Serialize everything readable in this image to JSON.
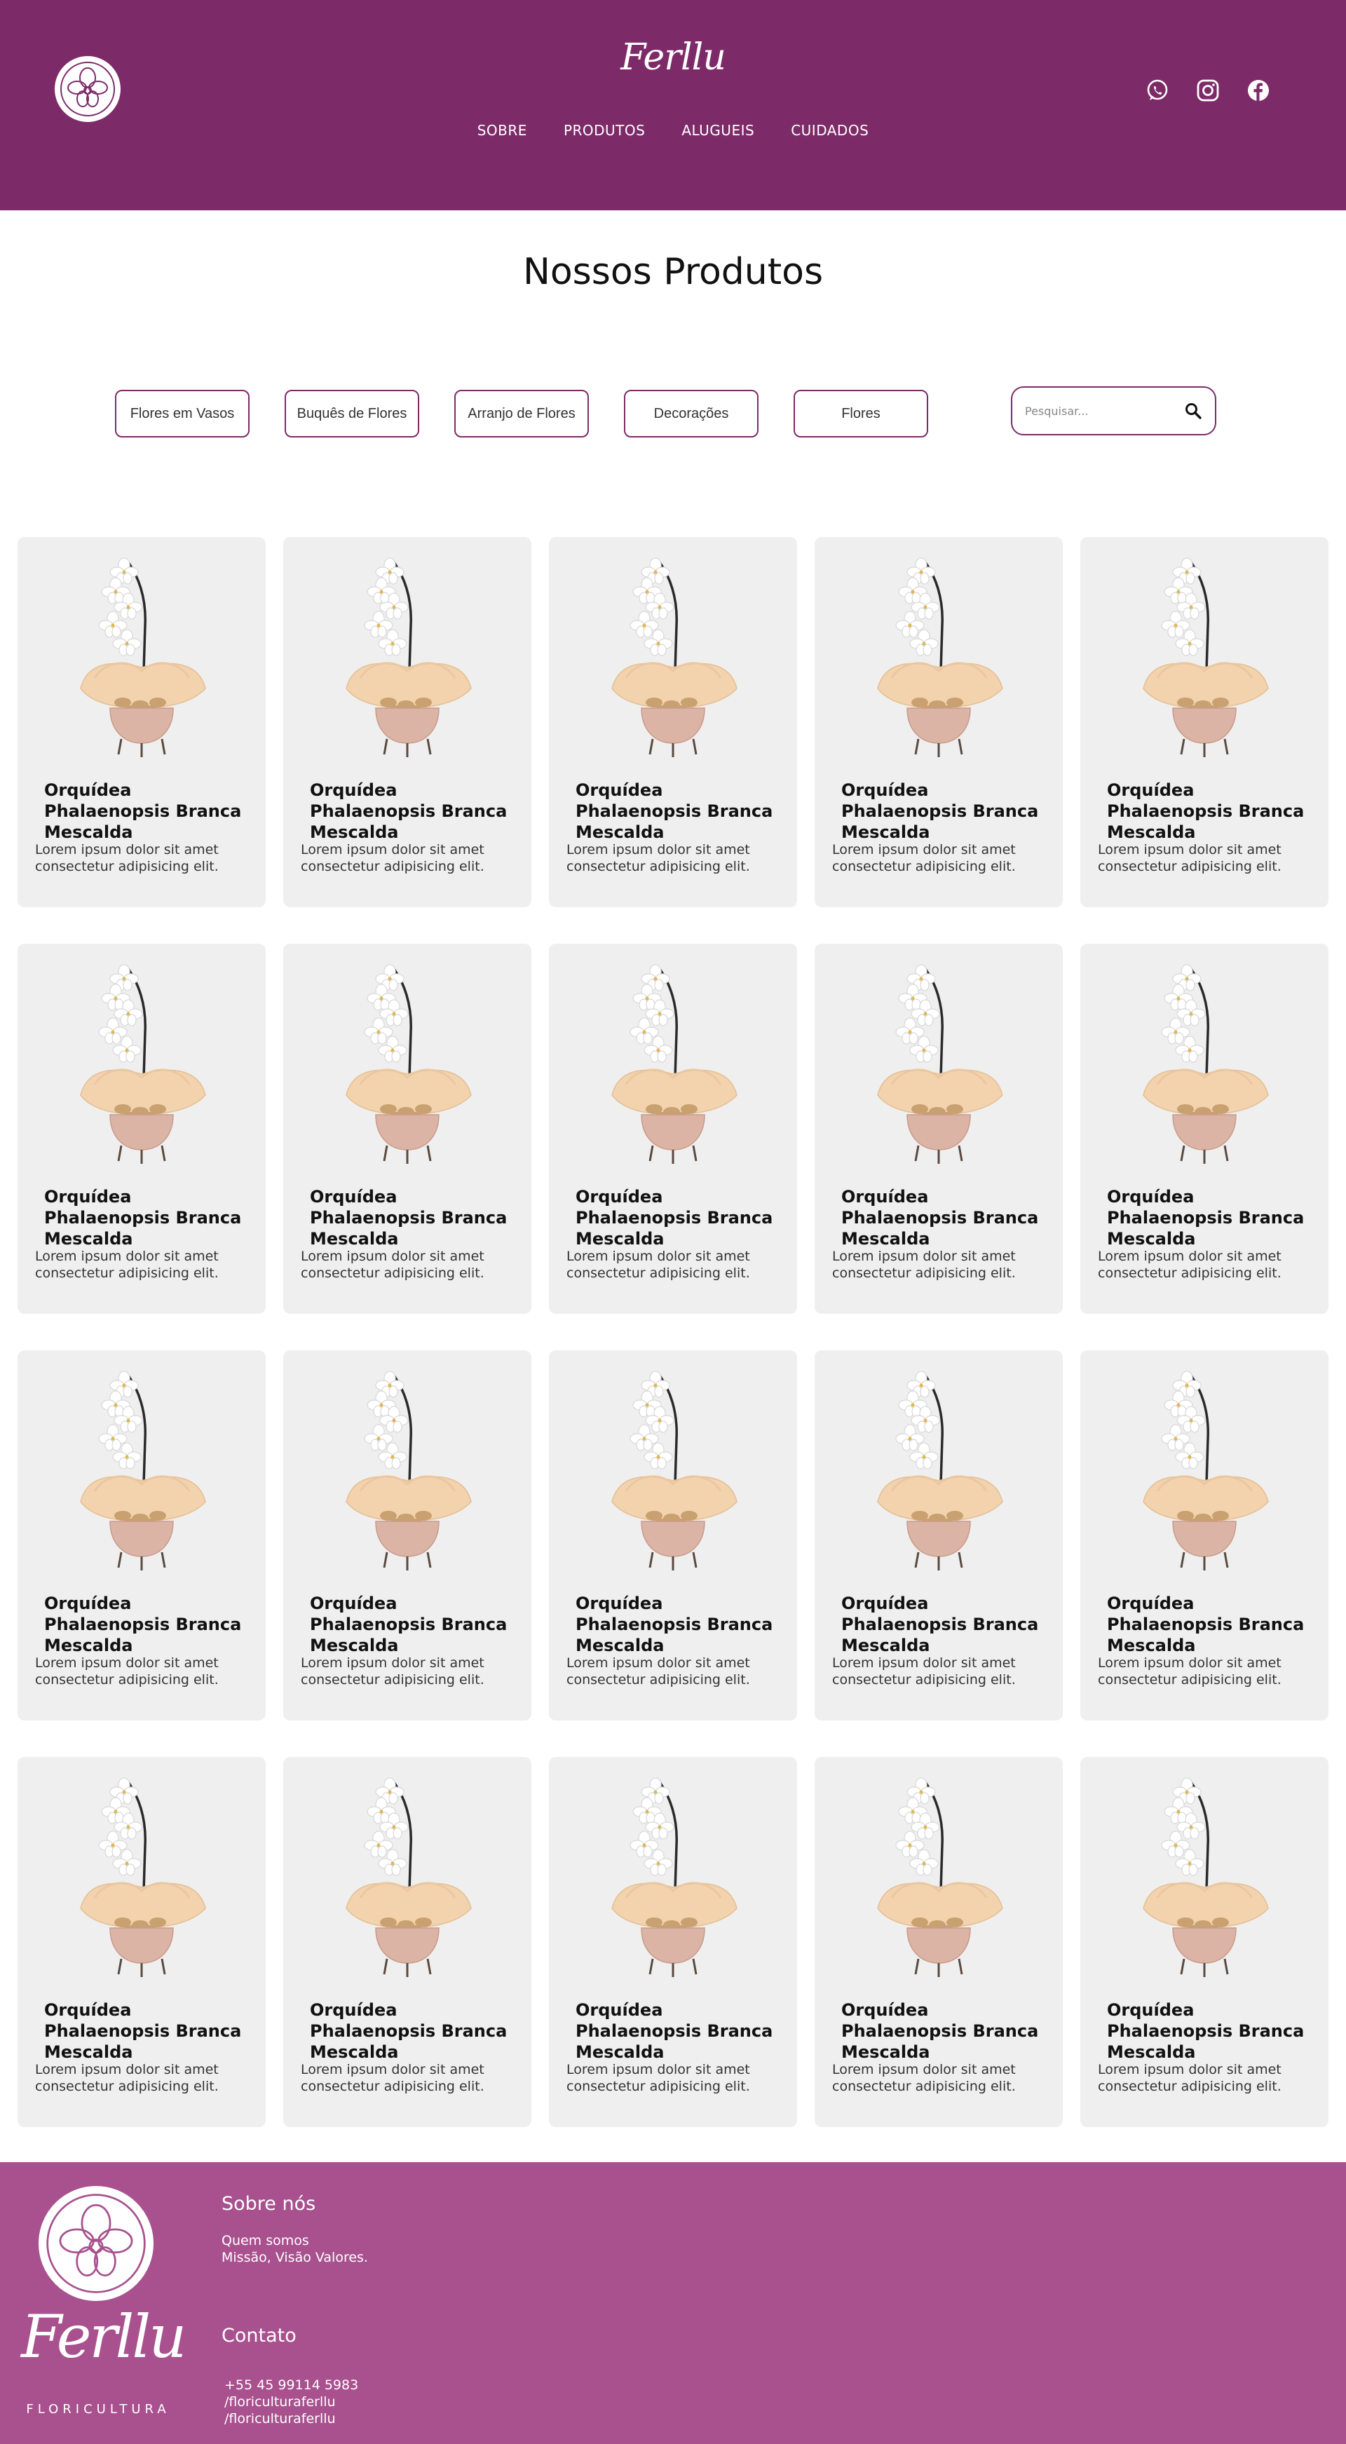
{
  "header": {
    "brand": "Ferllu",
    "nav": [
      "SOBRE",
      "PRODUTOS",
      "ALUGUEIS",
      "CUIDADOS"
    ],
    "social_icons": [
      "whatsapp-icon",
      "instagram-icon",
      "facebook-icon"
    ]
  },
  "page_title": "Nossos Produtos",
  "filters": [
    "Flores em Vasos",
    "Buquês de Flores",
    "Arranjo de Flores",
    "Decorações",
    "Flores"
  ],
  "search": {
    "placeholder": "Pesquisar..."
  },
  "product_image": "white-phalaenopsis-orchid-in-pink-pot",
  "products": [
    {
      "title": "Orquídea Phalaenopsis Branca Mescalda",
      "desc": "Lorem ipsum dolor sit amet consectetur adipisicing elit."
    },
    {
      "title": "Orquídea Phalaenopsis Branca Mescalda",
      "desc": "Lorem ipsum dolor sit amet consectetur adipisicing elit."
    },
    {
      "title": "Orquídea Phalaenopsis Branca Mescalda",
      "desc": "Lorem ipsum dolor sit amet consectetur adipisicing elit."
    },
    {
      "title": "Orquídea Phalaenopsis Branca Mescalda",
      "desc": "Lorem ipsum dolor sit amet consectetur adipisicing elit."
    },
    {
      "title": "Orquídea Phalaenopsis Branca Mescalda",
      "desc": "Lorem ipsum dolor sit amet consectetur adipisicing elit."
    },
    {
      "title": "Orquídea Phalaenopsis Branca Mescalda",
      "desc": "Lorem ipsum dolor sit amet consectetur adipisicing elit."
    },
    {
      "title": "Orquídea Phalaenopsis Branca Mescalda",
      "desc": "Lorem ipsum dolor sit amet consectetur adipisicing elit."
    },
    {
      "title": "Orquídea Phalaenopsis Branca Mescalda",
      "desc": "Lorem ipsum dolor sit amet consectetur adipisicing elit."
    },
    {
      "title": "Orquídea Phalaenopsis Branca Mescalda",
      "desc": "Lorem ipsum dolor sit amet consectetur adipisicing elit."
    },
    {
      "title": "Orquídea Phalaenopsis Branca Mescalda",
      "desc": "Lorem ipsum dolor sit amet consectetur adipisicing elit."
    },
    {
      "title": "Orquídea Phalaenopsis Branca Mescalda",
      "desc": "Lorem ipsum dolor sit amet consectetur adipisicing elit."
    },
    {
      "title": "Orquídea Phalaenopsis Branca Mescalda",
      "desc": "Lorem ipsum dolor sit amet consectetur adipisicing elit."
    },
    {
      "title": "Orquídea Phalaenopsis Branca Mescalda",
      "desc": "Lorem ipsum dolor sit amet consectetur adipisicing elit."
    },
    {
      "title": "Orquídea Phalaenopsis Branca Mescalda",
      "desc": "Lorem ipsum dolor sit amet consectetur adipisicing elit."
    },
    {
      "title": "Orquídea Phalaenopsis Branca Mescalda",
      "desc": "Lorem ipsum dolor sit amet consectetur adipisicing elit."
    },
    {
      "title": "Orquídea Phalaenopsis Branca Mescalda",
      "desc": "Lorem ipsum dolor sit amet consectetur adipisicing elit."
    },
    {
      "title": "Orquídea Phalaenopsis Branca Mescalda",
      "desc": "Lorem ipsum dolor sit amet consectetur adipisicing elit."
    },
    {
      "title": "Orquídea Phalaenopsis Branca Mescalda",
      "desc": "Lorem ipsum dolor sit amet consectetur adipisicing elit."
    },
    {
      "title": "Orquídea Phalaenopsis Branca Mescalda",
      "desc": "Lorem ipsum dolor sit amet consectetur adipisicing elit."
    },
    {
      "title": "Orquídea Phalaenopsis Branca Mescalda",
      "desc": "Lorem ipsum dolor sit amet consectetur adipisicing elit."
    }
  ],
  "footer": {
    "brand": "Ferllu",
    "tagline": "FLORICULTURA",
    "about_heading": "Sobre nós",
    "about_line1": "Quem somos",
    "about_line2": "Missão, Visão Valores.",
    "contact_heading": "Contato",
    "phone": "+55 45 99114 5983",
    "handle1": "/floriculturaferllu",
    "handle2": "/floriculturaferllu"
  },
  "colors": {
    "header_bg": "#7d2b68",
    "footer_bg": "#a8518e",
    "card_bg": "#efefef",
    "accent": "#7d2b68"
  }
}
